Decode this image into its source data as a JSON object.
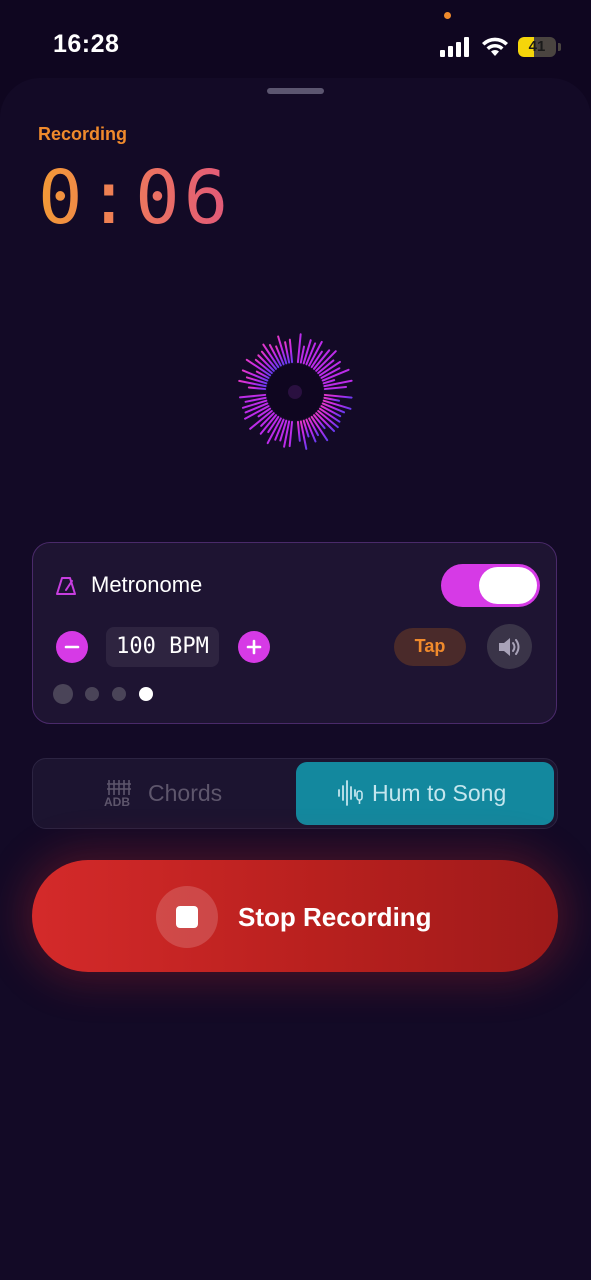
{
  "status_bar": {
    "time": "16:28",
    "battery_level": "41",
    "battery_fraction": 0.41,
    "icons": [
      "cellular-signal-icon",
      "wifi-icon",
      "battery-icon"
    ]
  },
  "recording": {
    "label": "Recording",
    "elapsed": "0:06"
  },
  "metronome": {
    "title": "Metronome",
    "enabled": true,
    "bpm_display": "100 BPM",
    "tap_label": "Tap",
    "beats_total": 4,
    "current_beat": 4,
    "icons": [
      "metronome-icon",
      "minus-icon",
      "plus-icon",
      "speaker-icon"
    ]
  },
  "modes": {
    "items": [
      {
        "label": "Chords",
        "icon": "guitar-chords-icon",
        "selected": false
      },
      {
        "label": "Hum to Song",
        "icon": "waveform-mic-icon",
        "selected": true
      }
    ]
  },
  "stop_button": {
    "label": "Stop Recording",
    "icon": "stop-icon"
  },
  "colors": {
    "background": "#0f0620",
    "accent_orange": "#f08a2c",
    "accent_magenta": "#d63ae6",
    "teal_selected": "#13889e",
    "stop_red": "#c22424"
  }
}
